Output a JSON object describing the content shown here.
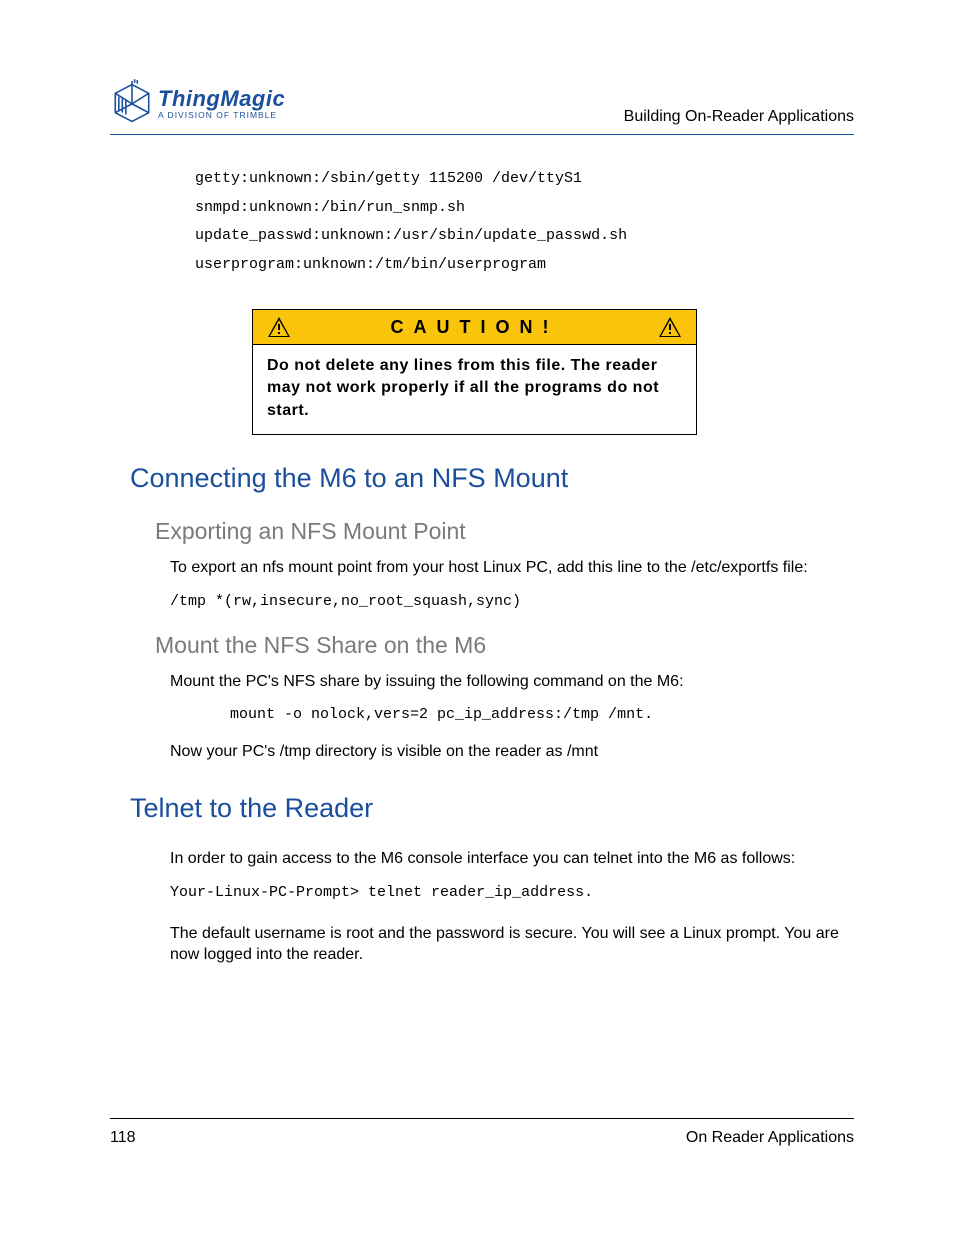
{
  "header": {
    "running_head": "Building On-Reader Applications",
    "logo_title": "ThingMagic",
    "logo_subtitle": "A DIVISION OF TRIMBLE"
  },
  "code_lines": {
    "l1": "getty:unknown:/sbin/getty 115200 /dev/ttyS1",
    "l2": "snmpd:unknown:/bin/run_snmp.sh",
    "l3": "update_passwd:unknown:/usr/sbin/update_passwd.sh",
    "l4": "userprogram:unknown:/tm/bin/userprogram"
  },
  "caution": {
    "title": "CAUTION!",
    "body": "Do not delete any lines from this file. The reader may not work properly if all the pro­grams do not start."
  },
  "section1": {
    "heading": "Connecting the M6 to an NFS Mount",
    "sub1": {
      "heading": "Exporting an NFS Mount Point",
      "p1": "To export an nfs mount point from your host Linux PC, add this line to the /etc/exportfs file:",
      "code": "/tmp *(rw,insecure,no_root_squash,sync)"
    },
    "sub2": {
      "heading": "Mount the NFS Share on the M6",
      "p1": "Mount the PC's NFS share by issuing the following command on the M6:",
      "code": "mount -o nolock,vers=2 pc_ip_address:/tmp /mnt.",
      "p2": "Now your PC's /tmp directory is visible on the reader as /mnt"
    }
  },
  "section2": {
    "heading": "Telnet to the Reader",
    "p1": "In order to gain access to the M6 console interface you can telnet into the M6 as follows:",
    "code_prefix": "Your-Linux-PC-Prompt> ",
    "code_cmd": "telnet reader_ip_address.",
    "p2": "The default username is root and the password is secure. You will see a Linux prompt. You are now logged into the reader."
  },
  "footer": {
    "page_number": "118",
    "section_label": "On Reader Applications"
  }
}
